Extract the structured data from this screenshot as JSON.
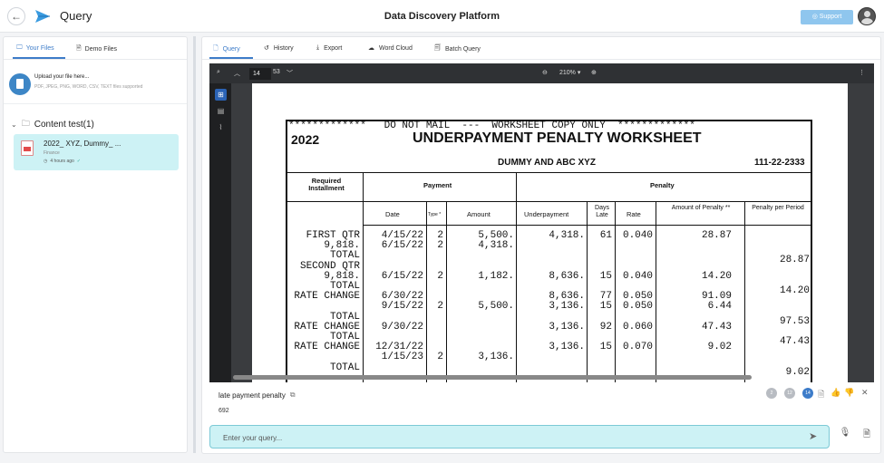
{
  "header": {
    "app_title": "Query",
    "platform_title": "Data Discovery Platform",
    "support_label": "◎ Support"
  },
  "sidebar": {
    "tabs": [
      {
        "label": "Your Files",
        "active": true
      },
      {
        "label": "Demo Files",
        "active": false
      }
    ],
    "upload": {
      "title": "Upload your file here...",
      "subtitle": "PDF, JPEG, PNG, WORD, CSV, TEXT files supported"
    },
    "folder": {
      "label": "Content test(1)"
    },
    "files": [
      {
        "name": "2022_ XYZ, Dummy_ ...",
        "category": "Finance",
        "time": "4 hours ago"
      }
    ]
  },
  "main": {
    "tabs": [
      {
        "label": "Query",
        "active": true
      },
      {
        "label": "History"
      },
      {
        "label": "Export"
      },
      {
        "label": "Word Cloud"
      },
      {
        "label": "Batch Query"
      }
    ]
  },
  "viewer": {
    "current_page": "14",
    "total_pages": "53",
    "zoom": "210% ▾"
  },
  "document": {
    "banner": "*************   DO NOT MAIL  ---  WORKSHEET COPY ONLY  *************",
    "year": "2022",
    "title": "UNDERPAYMENT PENALTY WORKSHEET",
    "taxpayer": "DUMMY AND ABC XYZ",
    "ssn": "111-22-2333",
    "group_required": "Required Installment",
    "group_payment": "Payment",
    "group_penalty": "Penalty",
    "columns": [
      "Date",
      "Type *",
      "Amount",
      "Underpayment",
      "Days Late",
      "Rate",
      "Amount of Penalty **",
      "Penalty per Period"
    ],
    "rows": [
      {
        "label": "FIRST QTR",
        "date": "4/15/22",
        "type": "2",
        "amount": "5,500.",
        "under": "4,318.",
        "days": "61",
        "rate": "0.040",
        "pen": "28.87",
        "per": ""
      },
      {
        "label": "9,818.",
        "date": "6/15/22",
        "type": "2",
        "amount": "4,318.",
        "under": "",
        "days": "",
        "rate": "",
        "pen": "",
        "per": ""
      },
      {
        "label": "TOTAL",
        "date": "",
        "type": "",
        "amount": "",
        "under": "",
        "days": "",
        "rate": "",
        "pen": "",
        "per": "28.87"
      },
      {
        "label": "SECOND QTR",
        "date": "",
        "type": "",
        "amount": "",
        "under": "",
        "days": "",
        "rate": "",
        "pen": "",
        "per": ""
      },
      {
        "label": "9,818.",
        "date": "6/15/22",
        "type": "2",
        "amount": "1,182.",
        "under": "8,636.",
        "days": "15",
        "rate": "0.040",
        "pen": "14.20",
        "per": ""
      },
      {
        "label": "TOTAL",
        "date": "",
        "type": "",
        "amount": "",
        "under": "",
        "days": "",
        "rate": "",
        "pen": "",
        "per": "14.20"
      },
      {
        "label": "RATE CHANGE",
        "date": "6/30/22",
        "type": "",
        "amount": "",
        "under": "8,636.",
        "days": "77",
        "rate": "0.050",
        "pen": "91.09",
        "per": ""
      },
      {
        "label": "",
        "date": "9/15/22",
        "type": "2",
        "amount": "5,500.",
        "under": "3,136.",
        "days": "15",
        "rate": "0.050",
        "pen": "6.44",
        "per": ""
      },
      {
        "label": "TOTAL",
        "date": "",
        "type": "",
        "amount": "",
        "under": "",
        "days": "",
        "rate": "",
        "pen": "",
        "per": "97.53"
      },
      {
        "label": "RATE CHANGE",
        "date": "9/30/22",
        "type": "",
        "amount": "",
        "under": "3,136.",
        "days": "92",
        "rate": "0.060",
        "pen": "47.43",
        "per": ""
      },
      {
        "label": "TOTAL",
        "date": "",
        "type": "",
        "amount": "",
        "under": "",
        "days": "",
        "rate": "",
        "pen": "",
        "per": "47.43"
      },
      {
        "label": "RATE CHANGE",
        "date": "12/31/22",
        "type": "",
        "amount": "",
        "under": "3,136.",
        "days": "15",
        "rate": "0.070",
        "pen": "9.02",
        "per": ""
      },
      {
        "label": "",
        "date": "1/15/23",
        "type": "2",
        "amount": "3,136.",
        "under": "",
        "days": "",
        "rate": "",
        "pen": "",
        "per": ""
      },
      {
        "label": "TOTAL",
        "date": "",
        "type": "",
        "amount": "",
        "under": "",
        "days": "",
        "rate": "",
        "pen": "",
        "per": "9.02"
      }
    ]
  },
  "answer": {
    "question": "late payment penalty",
    "value": "692",
    "citations": [
      "2",
      "12",
      "14"
    ],
    "active_citation": "14"
  },
  "query": {
    "placeholder": "Enter your query..."
  }
}
